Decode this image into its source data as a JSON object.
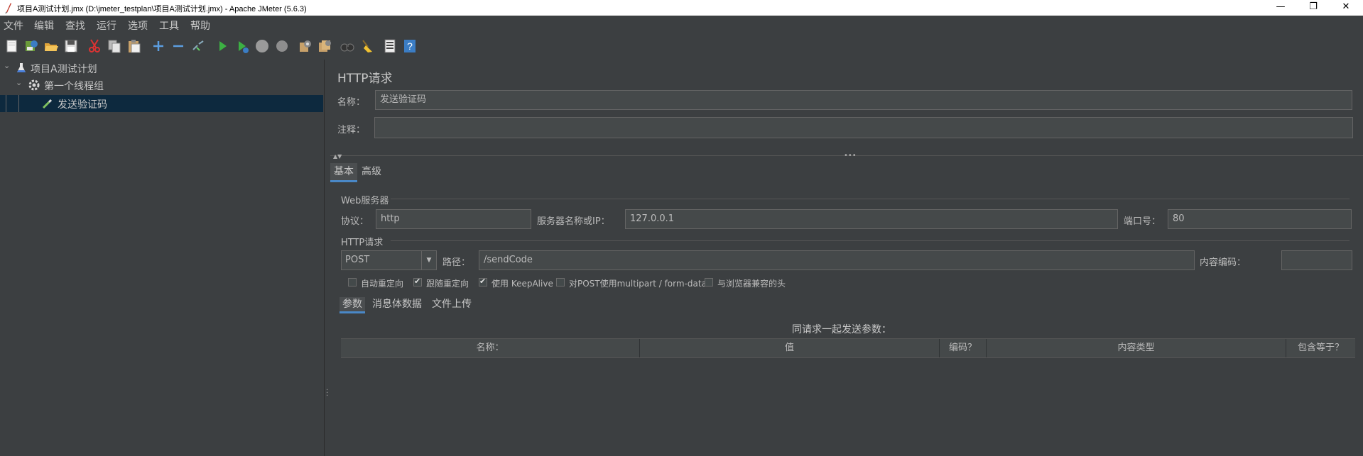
{
  "window": {
    "title": "项目A测试计划.jmx (D:\\jmeter_testplan\\项目A测试计划.jmx) - Apache JMeter (5.6.3)",
    "minimize": "—",
    "maximize": "❐",
    "close": "✕"
  },
  "menu": [
    "文件",
    "编辑",
    "查找",
    "运行",
    "选项",
    "工具",
    "帮助"
  ],
  "toolbar_icons": [
    "new-icon",
    "templates-icon",
    "open-icon",
    "save-icon",
    "cut-icon",
    "copy-icon",
    "paste-icon",
    "expand-icon",
    "collapse-icon",
    "toggle-icon",
    "start-icon",
    "start-no-timers-icon",
    "stop-icon",
    "shutdown-icon",
    "clear-icon",
    "clear-all-icon",
    "search-icon",
    "reset-search-icon",
    "function-helper-icon",
    "help-icon"
  ],
  "tree": {
    "items": [
      {
        "label": "项目A测试计划",
        "icon": "test-plan-flask-icon",
        "expanded": true
      },
      {
        "label": "第一个线程组",
        "icon": "thread-group-gear-icon",
        "expanded": true
      },
      {
        "label": "发送验证码",
        "icon": "http-sampler-pipette-icon",
        "selected": true
      }
    ]
  },
  "sampler": {
    "heading": "HTTP请求",
    "name_label": "名称：",
    "name_value": "发送验证码",
    "comment_label": "注释：",
    "comment_value": ""
  },
  "tabs": {
    "basic": "基本",
    "advanced": "高级"
  },
  "web_server": {
    "section": "Web服务器",
    "protocol_label": "协议：",
    "protocol_value": "http",
    "server_label": "服务器名称或IP：",
    "server_value": "127.0.0.1",
    "port_label": "端口号：",
    "port_value": "80"
  },
  "http_request": {
    "section": "HTTP请求",
    "method": "POST",
    "path_label": "路径：",
    "path_value": "/sendCode",
    "encoding_label": "内容编码：",
    "encoding_value": ""
  },
  "options": [
    {
      "label": "自动重定向",
      "checked": false
    },
    {
      "label": "跟随重定向",
      "checked": true
    },
    {
      "label": "使用 KeepAlive",
      "checked": true
    },
    {
      "label": "对POST使用multipart / form-data",
      "checked": false
    },
    {
      "label": "与浏览器兼容的头",
      "checked": false
    }
  ],
  "subtabs": {
    "params": "参数",
    "body": "消息体数据",
    "files": "文件上传"
  },
  "params_table": {
    "caption": "同请求一起发送参数：",
    "columns": [
      "名称：",
      "值",
      "编码？",
      "内容类型",
      "包含等于？"
    ]
  }
}
